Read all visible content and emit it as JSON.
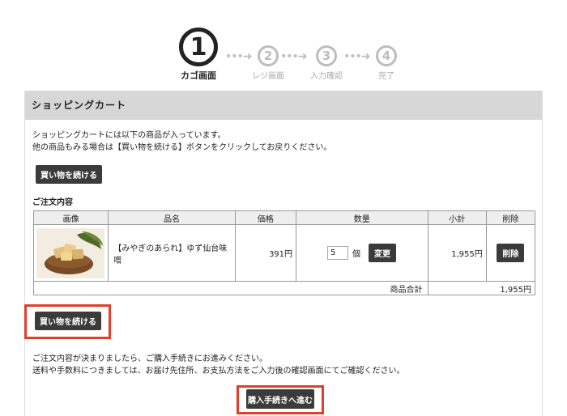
{
  "steps": [
    {
      "num": "1",
      "label": "カゴ画面",
      "active": true
    },
    {
      "num": "2",
      "label": "レジ画面",
      "active": false
    },
    {
      "num": "3",
      "label": "入力確認",
      "active": false
    },
    {
      "num": "4",
      "label": "完了",
      "active": false
    }
  ],
  "arrow_glyph": "•••➜",
  "panel": {
    "title": "ショッピングカート",
    "intro_line1": "ショッピングカートには以下の商品が入っています。",
    "intro_line2": "他の商品もみる場合は【買い物を続ける】ボタンをクリックしてお戻りください。",
    "continue_label": "買い物を続ける",
    "order_title": "ご注文内容"
  },
  "table": {
    "headers": [
      "画像",
      "品名",
      "価格",
      "数量",
      "小計",
      "削除"
    ],
    "items": [
      {
        "name": "【みやぎのあられ】ゆず仙台味噌",
        "price": "391円",
        "qty": "5",
        "unit": "個",
        "change_label": "変更",
        "subtotal": "1,955円",
        "delete_label": "削除"
      }
    ],
    "total_label": "商品合計",
    "total_value": "1,955円"
  },
  "notice": {
    "line1": "ご注文内容が決まりましたら、ご購入手続きにお進みください。",
    "line2": "送料や手数料につきましては、お届け先住所、お支払方法をご入力後の確認画面にてご確認ください。"
  },
  "checkout_label": "購入手続きへ進む",
  "colors": {
    "highlight": "#e0402a",
    "button": "#3b3b3b",
    "header_bg": "#d7d7d7"
  }
}
